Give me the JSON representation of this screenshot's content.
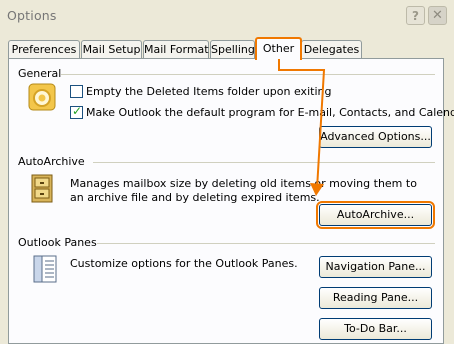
{
  "window": {
    "title": "Options"
  },
  "tabs": [
    "Preferences",
    "Mail Setup",
    "Mail Format",
    "Spelling",
    "Other",
    "Delegates"
  ],
  "active_tab": "Other",
  "general": {
    "heading": "General",
    "empty_deleted_label": "Empty the Deleted Items folder upon exiting",
    "empty_deleted_checked": false,
    "default_program_label": "Make Outlook the default program for E-mail, Contacts, and Calendar.",
    "default_program_checked": true,
    "advanced_button": "Advanced Options..."
  },
  "autoarchive": {
    "heading": "AutoArchive",
    "description": "Manages mailbox size by deleting old items or moving them to an archive file and by deleting expired items.",
    "button": "AutoArchive..."
  },
  "panes": {
    "heading": "Outlook Panes",
    "description": "Customize options for the Outlook Panes.",
    "navigation_button": "Navigation Pane...",
    "reading_button": "Reading Pane...",
    "todo_button": "To-Do Bar..."
  },
  "colors": {
    "highlight": "#f07800",
    "face": "#ece9d8"
  }
}
